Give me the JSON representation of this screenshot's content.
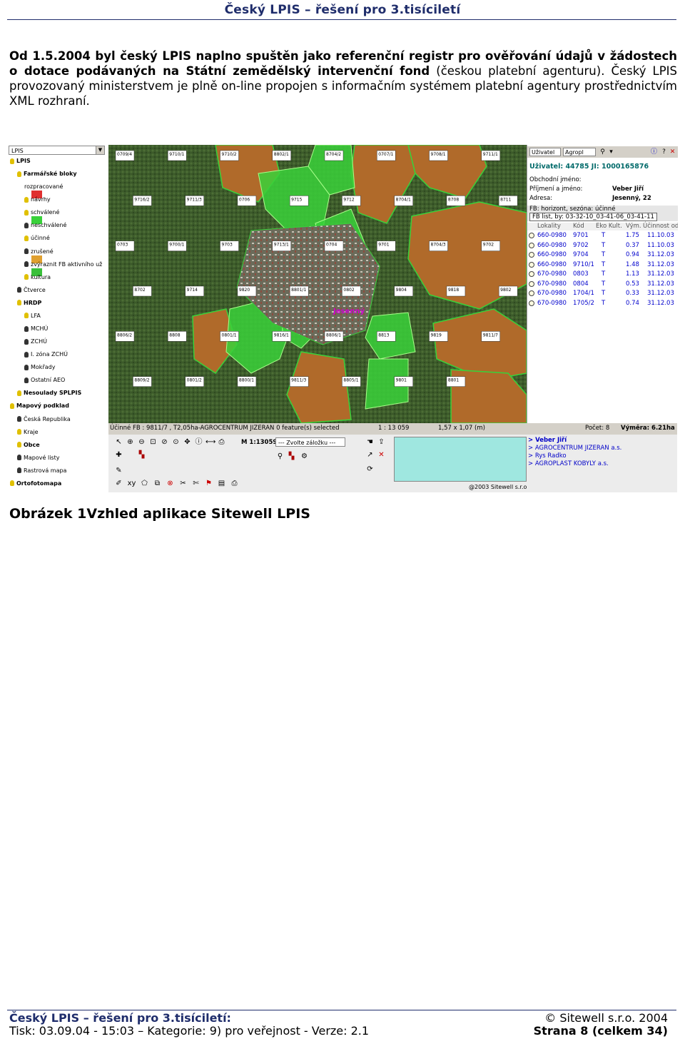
{
  "header": {
    "title": "Český LPIS – řešení pro 3.tisíciletí"
  },
  "intro": {
    "bold_part": "Od 1.5.2004 byl český LPIS naplno spuštěn jako referenční registr pro ověřování údajů v žádostech o dotace podávaných na Státní zemědělský intervenční fond",
    "normal_part": " (českou platební agenturu). Český LPIS provozovaný ministerstvem je plně on-line propojen s informačním systémem platební agentury prostřednictvím XML rozhraní."
  },
  "app": {
    "tree": {
      "select_value": "LPIS",
      "items": [
        {
          "label": "LPIS",
          "bold": true,
          "indent": 0,
          "bulb": "#e0c000"
        },
        {
          "label": "Farmářské bloky",
          "bold": true,
          "indent": 1,
          "bulb": "#e0c000"
        },
        {
          "label": "rozpracované",
          "indent": 2,
          "swatch": "#e03030"
        },
        {
          "label": "návrhy",
          "indent": 2,
          "bulb": "#e0c000"
        },
        {
          "label": "schválené",
          "indent": 2,
          "bulb": "#e0c000",
          "swatch": "#39d13a"
        },
        {
          "label": "neschválené",
          "indent": 2,
          "bulb": "#333333"
        },
        {
          "label": "účinné",
          "indent": 2,
          "bulb": "#e0c000"
        },
        {
          "label": "zrušené",
          "indent": 2,
          "bulb": "#333333",
          "swatch": "#e0a030"
        },
        {
          "label": "zvýraznit FB aktivního už",
          "indent": 2,
          "bulb": "#333333",
          "swatch": "#39c03a"
        },
        {
          "label": "kultura",
          "indent": 2,
          "bulb": "#e0c000"
        },
        {
          "label": "Čtverce",
          "indent": 1,
          "bulb": "#333333"
        },
        {
          "label": "HRDP",
          "bold": true,
          "indent": 1,
          "bulb": "#e0c000"
        },
        {
          "label": "LFA",
          "indent": 2,
          "bulb": "#e0c000"
        },
        {
          "label": "MCHÚ",
          "indent": 2,
          "bulb": "#333333"
        },
        {
          "label": "ZCHÚ",
          "indent": 2,
          "bulb": "#333333"
        },
        {
          "label": "I. zóna ZCHÚ",
          "indent": 2,
          "bulb": "#333333"
        },
        {
          "label": "Mokřady",
          "indent": 2,
          "bulb": "#333333"
        },
        {
          "label": "Ostatní AEO",
          "indent": 2,
          "bulb": "#333333"
        },
        {
          "label": "Nesoulady SPLPIS",
          "bold": true,
          "indent": 1,
          "bulb": "#e0c000"
        },
        {
          "label": "Mapový podklad",
          "bold": true,
          "indent": 0,
          "bulb": "#e0c000"
        },
        {
          "label": "Česká Republika",
          "indent": 1,
          "bulb": "#333333"
        },
        {
          "label": "Kraje",
          "indent": 1,
          "bulb": "#e0c000"
        },
        {
          "label": "Obce",
          "bold": true,
          "indent": 1,
          "bulb": "#e0c000"
        },
        {
          "label": "Mapové listy",
          "indent": 1,
          "bulb": "#333333"
        },
        {
          "label": "Rastrová mapa",
          "indent": 1,
          "bulb": "#333333"
        },
        {
          "label": "Ortofotomapa",
          "bold": true,
          "indent": 0,
          "bulb": "#e0c000"
        }
      ]
    },
    "map": {
      "town_label": "Jesenný",
      "parcel_labels": [
        "0709/4",
        "9710/1",
        "9710/2",
        "8802/1",
        "8704/2",
        "0707/1",
        "9708/1",
        "9711/1",
        "9716/2",
        "9711/3",
        "0706",
        "9715",
        "9712",
        "8704/1",
        "8708",
        "8711",
        "0703",
        "9700/1",
        "9703",
        "9713/1",
        "0704",
        "9701",
        "8704/3",
        "9702",
        "8702",
        "9714",
        "9820",
        "8801/1",
        "0802",
        "9804",
        "9818",
        "9802",
        "8806/2",
        "8808",
        "0801/1",
        "9816/1",
        "8806/1",
        "8813",
        "9819",
        "9811/7",
        "8809/2",
        "0801/2",
        "8800/1",
        "9811/3",
        "8805/1",
        "9801",
        "8801"
      ]
    },
    "right_panel": {
      "user_select": "Uživatel",
      "agro_select": "Agropl",
      "user_label": "Uživatel: 44785 JI: 1000165876",
      "fields": [
        {
          "label": "Obchodní jméno:",
          "value": ""
        },
        {
          "label": "Příjmení a jméno:",
          "value": "Veber Jiří"
        },
        {
          "label": "Adresa:",
          "value": "Jesenný, 22"
        }
      ],
      "fb_list_label": "FB: horizont, sezóna: účinné",
      "fb_selected": "FB list, by: 03-32-10_03-41-06_03-41-11",
      "columns": [
        "Lokality",
        "Kód",
        "Eko Kult.",
        "Vým.",
        "Účinnost od"
      ],
      "rows": [
        {
          "lok": "660-0980",
          "kod": "9701",
          "kult": "T",
          "vym": "1.75",
          "od": "11.10.03"
        },
        {
          "lok": "660-0980",
          "kod": "9702",
          "kult": "T",
          "vym": "0.37",
          "od": "11.10.03"
        },
        {
          "lok": "660-0980",
          "kod": "9704",
          "kult": "T",
          "vym": "0.94",
          "od": "31.12.03"
        },
        {
          "lok": "660-0980",
          "kod": "9710/1",
          "kult": "T",
          "vym": "1.48",
          "od": "31.12.03"
        },
        {
          "lok": "670-0980",
          "kod": "0803",
          "kult": "T",
          "vym": "1.13",
          "od": "31.12.03"
        },
        {
          "lok": "670-0980",
          "kod": "0804",
          "kult": "T",
          "vym": "0.53",
          "od": "31.12.03"
        },
        {
          "lok": "670-0980",
          "kod": "1704/1",
          "kult": "T",
          "vym": "0.33",
          "od": "31.12.03"
        },
        {
          "lok": "670-0980",
          "kod": "1705/2",
          "kult": "T",
          "vym": "0.74",
          "od": "31.12.03"
        }
      ]
    },
    "status": {
      "feature": "Účinné FB : 9811/7 , T2,05ha-AGROCENTRUM JIZERAN 0 feature(s) selected",
      "scale": "1 : 13 059",
      "coords": "1,57 x 1,07 (m)",
      "page": "Počet: 8",
      "area": "Výměra: 6.21ha"
    },
    "toolbar": {
      "scale_label": "M 1:13059",
      "bookmark_select": "--- Zvolte záložku ---"
    },
    "subjects": [
      "> Veber Jiří",
      "> AGROCENTRUM JIZERAN a.s.",
      "> Rys Radko",
      "> AGROPLAST KOBYLY a.s."
    ],
    "copyright": "@2003 Sitewell s.r.o"
  },
  "caption": "Obrázek 1Vzhled aplikace Sitewell LPIS",
  "footer": {
    "left_title": "Český LPIS – řešení pro 3.tisíciletí:",
    "copyright": "© Sitewell s.r.o. 2004",
    "meta": "Tisk: 03.09.04 - 15:03 – Kategorie: 9) pro veřejnost  - Verze: 2.1",
    "page": "Strana 8 (celkem 34)"
  },
  "colors": {
    "accent": "#1f2d6b",
    "green": "#39d13a",
    "brown": "#b06a2a",
    "link": "#0000c8",
    "teal": "#9fe7e0"
  }
}
